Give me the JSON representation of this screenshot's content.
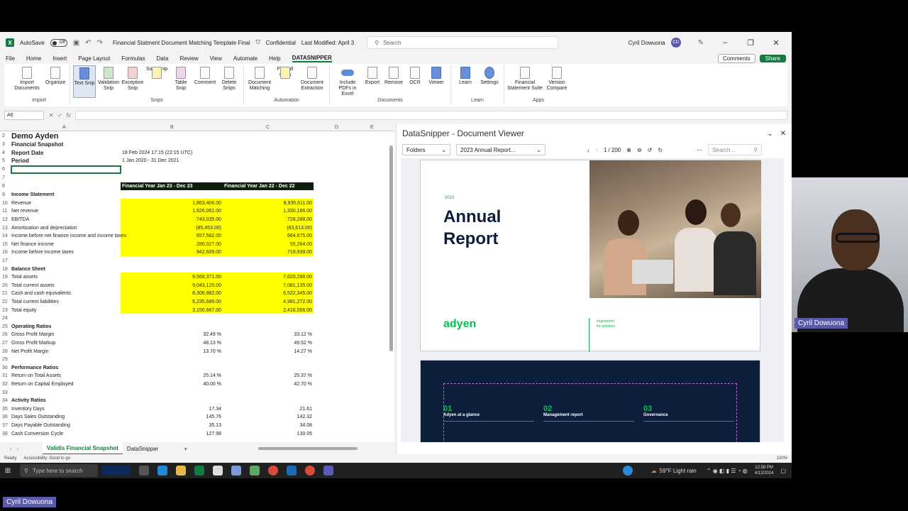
{
  "titlebar": {
    "autosave": "AutoSave",
    "autosave_state": "Off",
    "filename": "Financial Statment Document Matching Template Final",
    "sensitivity": "Confidential",
    "modified": "Last Modified: April 3",
    "search": "Search",
    "user": "Cyril Dowuona",
    "initials": "CD"
  },
  "menu": [
    "File",
    "Home",
    "Insert",
    "Page Layout",
    "Formulas",
    "Data",
    "Review",
    "View",
    "Automate",
    "Help",
    "DATASNIPPER"
  ],
  "menu_active": "DATASNIPPER",
  "comments": "Comments",
  "share": "Share",
  "ribbon": {
    "import": {
      "label": "Import",
      "items": [
        "Import Documents",
        "Organize"
      ]
    },
    "snips": {
      "label": "Snips",
      "items": [
        "Text Snip",
        "Validation Snip",
        "Exception Snip",
        "Sum Snip",
        "Table Snip",
        "Comment",
        "Delete Snips"
      ]
    },
    "automation": {
      "label": "Automation",
      "items": [
        "Document Matching",
        "Find all sums",
        "Document Extraction"
      ]
    },
    "documents": {
      "label": "Documents",
      "items": [
        "Include PDFs in Excel",
        "Export",
        "Remove",
        "OCR",
        "Viewer"
      ]
    },
    "learn": {
      "label": "Learn",
      "items": [
        "Learn",
        "Settings"
      ]
    },
    "apps": {
      "label": "Apps",
      "items": [
        "Financial Statement Suite",
        "Version Compare"
      ]
    }
  },
  "namebox": "A6",
  "columns": [
    "A",
    "B",
    "C",
    "D",
    "E"
  ],
  "sheet": {
    "title": "Demo Ayden",
    "subtitle": "Financial Snapshot",
    "report_date_label": "Report Date",
    "report_date": "18 Feb 2024 17:15 (22:15 UTC)",
    "period_label": "Period",
    "period": "1 Jan 2020 - 31 Dec 2021",
    "col_b_header": "Financial Year Jan 23 - Dec 23",
    "col_c_header": "Financial Year Jan 22 - Dec 22",
    "rows": [
      {
        "n": "9",
        "a": "Income Statement",
        "b": "",
        "c": "",
        "bold": true
      },
      {
        "n": "10",
        "a": "Revenue",
        "b": "1,863,406.00",
        "c": "8,935,611.00"
      },
      {
        "n": "11",
        "a": "Net revenue",
        "b": "1,626,061.00",
        "c": "1,330,166.00"
      },
      {
        "n": "12",
        "a": "EBITDA",
        "b": "743,035.00",
        "c": "728,288.00"
      },
      {
        "n": "13",
        "a": "Amortization and depreciation",
        "b": "(85,453.00)",
        "c": "(63,613.00)"
      },
      {
        "n": "14",
        "a": "Income before net finance income and income taxes",
        "b": "657,582.00",
        "c": "664,675.00"
      },
      {
        "n": "15",
        "a": "Net finance income",
        "b": "285,027.00",
        "c": "55,264.00"
      },
      {
        "n": "16",
        "a": "Income before income taxes",
        "b": "942,609.00",
        "c": "719,939.00"
      },
      {
        "n": "17",
        "a": "",
        "b": "",
        "c": ""
      },
      {
        "n": "18",
        "a": "Balance Sheet",
        "b": "",
        "c": "",
        "bold": true
      },
      {
        "n": "19",
        "a": "Total assets",
        "b": "9,568,371.00",
        "c": "7,620,288.00"
      },
      {
        "n": "20",
        "a": "Total current assets",
        "b": "9,043,120.00",
        "c": "7,081,135.00"
      },
      {
        "n": "21",
        "a": "Cash and cash equivalents",
        "b": "8,306,982.00",
        "c": "6,522,345.00"
      },
      {
        "n": "22",
        "a": "Total current liabilities",
        "b": "6,235,689.00",
        "c": "4,981,272.00"
      },
      {
        "n": "23",
        "a": "Total equity",
        "b": "3,150,667.00",
        "c": "2,416,056.00"
      },
      {
        "n": "24",
        "a": "",
        "b": "",
        "c": ""
      },
      {
        "n": "25",
        "a": "Operating Ratios",
        "b": "",
        "c": "",
        "bold": true
      },
      {
        "n": "26",
        "a": "Gross Profit Margin",
        "b": "32.49 %",
        "c": "33.12 %"
      },
      {
        "n": "27",
        "a": "Gross Profit Markup",
        "b": "48.13 %",
        "c": "49.52 %"
      },
      {
        "n": "28",
        "a": "Net Profit Margin",
        "b": "13.70 %",
        "c": "14.27 %"
      },
      {
        "n": "29",
        "a": "",
        "b": "",
        "c": ""
      },
      {
        "n": "30",
        "a": "Performance Ratios",
        "b": "",
        "c": "",
        "bold": true
      },
      {
        "n": "31",
        "a": "Return on Total Assets",
        "b": "25.14 %",
        "c": "25.37 %"
      },
      {
        "n": "32",
        "a": "Return on Capital Employed",
        "b": "40.00 %",
        "c": "42.70 %"
      },
      {
        "n": "33",
        "a": "",
        "b": "",
        "c": ""
      },
      {
        "n": "34",
        "a": "Activity Ratios",
        "b": "",
        "c": "",
        "bold": true
      },
      {
        "n": "35",
        "a": "Inventory Days",
        "b": "17.34",
        "c": "21.61"
      },
      {
        "n": "36",
        "a": "Days Sales Outstanding",
        "b": "145.76",
        "c": "142.32"
      },
      {
        "n": "37",
        "a": "Days Payable Outstanding",
        "b": "35.13",
        "c": "34.08"
      },
      {
        "n": "38",
        "a": "Cash Conversion Cycle",
        "b": "127.98",
        "c": "130.05"
      }
    ]
  },
  "sheet_tabs": [
    "Validis Financial Snapshot",
    "DataSnipper"
  ],
  "status": {
    "ready": "Ready",
    "accessibility": "Accessibility: Good to go",
    "zoom": "100%"
  },
  "viewer": {
    "title": "DataSnipper - Document Viewer",
    "folders": "Folders",
    "document": "2023 Annual Report...",
    "page": "1",
    "pages": "/ 200",
    "search": "Search...",
    "year": "2023",
    "report_title_1": "Annual",
    "report_title_2": "Report",
    "brand": "adyen",
    "tagline_1": "engineered",
    "tagline_2": "for ambition",
    "sections": [
      {
        "n": "01",
        "t": "Adyen at a glance"
      },
      {
        "n": "02",
        "t": "Management report"
      },
      {
        "n": "03",
        "t": "Governance"
      }
    ]
  },
  "participant": "Cyril Dowuona",
  "taskbar": {
    "search": "Type here to search",
    "weather": "59°F Light rain",
    "time": "12:58 PM",
    "date": "4/12/2024"
  }
}
